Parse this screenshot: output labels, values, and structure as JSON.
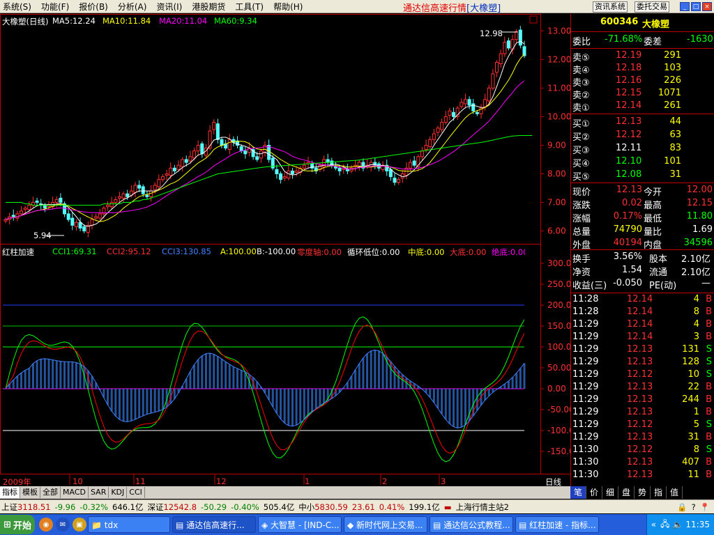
{
  "menu": {
    "items": [
      "系统(S)",
      "功能(F)",
      "报价(B)",
      "分析(A)",
      "资讯(I)",
      "港股期货",
      "工具(T)",
      "帮助(H)"
    ]
  },
  "app_title": "通达信高速行情",
  "app_title_tag": "[大橡塑]",
  "top_buttons": [
    "资讯系统",
    "委托交易"
  ],
  "window_controls": [
    "_",
    "□",
    "×"
  ],
  "chart_header": {
    "name": "大橡塑(日线)",
    "ma5": "MA5:12.24",
    "ma10": "MA10:11.84",
    "ma20": "MA20:11.04",
    "ma60": "MA60:9.34",
    "high_label": "12.98",
    "low_label": "5.94"
  },
  "indicator_header": {
    "name": "红柱加速",
    "cci1": "CCI1:69.31",
    "cci2": "CCI2:95.12",
    "cci3": "CCI3:130.85",
    "a": "A:100.00",
    "b": "B:-100.00",
    "zero": "零度轴:0.00",
    "cyc": "循环低位:0.00",
    "mid": "中底:0.00",
    "big": "大底:0.00",
    "abs": "绝底:0.00"
  },
  "x_axis": {
    "labels": [
      "2009年",
      "10",
      "11",
      "12",
      "1",
      "2",
      "3"
    ],
    "period": "日线"
  },
  "chart_data": [
    {
      "type": "candlestick",
      "title": "大橡塑(日线)",
      "ylim": [
        5.6,
        13.3
      ],
      "ticks": [
        "13.00",
        "12.00",
        "11.00",
        "10.00",
        "9.00",
        "8.00",
        "7.00",
        "6.00"
      ],
      "series": [
        {
          "name": "MA5:12.24",
          "color": "#ffffff"
        },
        {
          "name": "MA10:11.84",
          "color": "#ffff00"
        },
        {
          "name": "MA20:11.04",
          "color": "#ff00ff"
        },
        {
          "name": "MA60:9.34",
          "color": "#00ff00"
        }
      ],
      "close": [
        6.4,
        6.5,
        6.5,
        6.6,
        6.7,
        6.8,
        6.9,
        7.0,
        7.0,
        6.9,
        6.8,
        6.9,
        7.0,
        7.1,
        7.0,
        6.6,
        6.4,
        6.2,
        6.3,
        6.1,
        6.0,
        6.2,
        6.4,
        6.5,
        6.6,
        6.8,
        6.9,
        7.0,
        7.1,
        7.2,
        7.3,
        7.2,
        7.4,
        7.6,
        7.5,
        7.3,
        7.2,
        7.4,
        7.6,
        7.8,
        7.9,
        8.0,
        8.2,
        8.1,
        8.3,
        8.5,
        8.4,
        8.6,
        8.8,
        9.0,
        8.7,
        8.9,
        9.5,
        9.8,
        9.2,
        9.0,
        8.9,
        9.2,
        9.1,
        9.0,
        8.8,
        8.7,
        8.9,
        8.6,
        8.5,
        8.8,
        9.0,
        8.5,
        8.2,
        8.0,
        7.8,
        7.9,
        8.1,
        8.0,
        8.1,
        8.2,
        8.3,
        8.4,
        8.2,
        8.1,
        8.3,
        8.5,
        8.4,
        8.3,
        8.2,
        8.1,
        8.2,
        8.1,
        8.2,
        8.3,
        8.4,
        8.2,
        8.3,
        8.4,
        8.3,
        8.2,
        8.3,
        8.1,
        7.9,
        7.7,
        7.8,
        8.0,
        8.2,
        8.4,
        8.3,
        8.6,
        8.8,
        9.0,
        9.2,
        9.4,
        9.6,
        9.8,
        10.0,
        10.2,
        10.0,
        10.3,
        10.5,
        10.6,
        10.4,
        10.2,
        10.1,
        10.3,
        10.6,
        11.0,
        11.5,
        11.9,
        12.2,
        12.6,
        12.4,
        12.7,
        12.98,
        12.5,
        12.13
      ],
      "ma60": [
        7.0,
        7.0,
        7.0,
        7.0,
        7.0,
        6.95,
        6.95,
        6.9,
        6.9,
        6.9,
        6.9,
        6.9,
        6.9,
        6.9,
        6.9,
        6.9,
        6.9,
        6.9,
        6.9,
        6.9,
        6.9,
        6.9,
        6.9,
        6.9,
        6.9,
        6.95,
        6.95,
        6.95,
        6.95,
        6.95,
        7.0,
        7.0,
        7.0,
        7.05,
        7.05,
        7.1,
        7.1,
        7.15,
        7.2,
        7.25,
        7.3,
        7.35,
        7.4,
        7.45,
        7.5,
        7.55,
        7.6,
        7.65,
        7.7,
        7.75,
        7.8,
        7.85,
        7.9,
        7.95,
        8.0,
        8.02,
        8.04,
        8.06,
        8.08,
        8.1,
        8.12,
        8.14,
        8.16,
        8.18,
        8.2,
        8.22,
        8.24,
        8.25,
        8.26,
        8.27,
        8.28,
        8.29,
        8.3,
        8.31,
        8.32,
        8.33,
        8.34,
        8.35,
        8.36,
        8.37,
        8.38,
        8.39,
        8.4,
        8.41,
        8.42,
        8.43,
        8.44,
        8.45,
        8.46,
        8.47,
        8.48,
        8.5,
        8.52,
        8.54,
        8.56,
        8.58,
        8.6,
        8.62,
        8.64,
        8.66,
        8.68,
        8.7,
        8.72,
        8.74,
        8.76,
        8.78,
        8.8,
        8.82,
        8.84,
        8.86,
        8.88,
        8.9,
        8.92,
        8.94,
        8.96,
        8.98,
        9.0,
        9.02,
        9.04,
        9.06,
        9.08,
        9.1,
        9.12,
        9.15,
        9.18,
        9.21,
        9.24,
        9.27,
        9.3,
        9.32,
        9.33,
        9.34,
        9.34,
        9.34,
        9.34
      ]
    },
    {
      "type": "line",
      "title": "红柱加速",
      "ylim": [
        -200,
        330
      ],
      "ticks": [
        "300.00",
        "250.00",
        "200.00",
        "150.00",
        "100.00",
        "50.00",
        "0.00",
        "-50.00",
        "-100.00",
        "-150.00"
      ],
      "series": [
        {
          "name": "CCI1:69.31",
          "color": "#00ff00"
        },
        {
          "name": "CCI2:95.12",
          "color": "#ff0000"
        },
        {
          "name": "CCI3:130.85",
          "color": "#4080ff"
        }
      ],
      "reference_lines": [
        200,
        150,
        100,
        0,
        -100
      ]
    }
  ],
  "stock": {
    "code": "600346",
    "name": "大橡塑"
  },
  "order_ratio": {
    "label1": "委比",
    "value1": "-71.68%",
    "label2": "委差",
    "value2": "-1630"
  },
  "asks": [
    {
      "label": "卖⑤",
      "price": "12.19",
      "vol": "291"
    },
    {
      "label": "卖④",
      "price": "12.18",
      "vol": "103"
    },
    {
      "label": "卖③",
      "price": "12.16",
      "vol": "226"
    },
    {
      "label": "卖②",
      "price": "12.15",
      "vol": "1071"
    },
    {
      "label": "卖①",
      "price": "12.14",
      "vol": "261"
    }
  ],
  "bids": [
    {
      "label": "买①",
      "price": "12.13",
      "vol": "44"
    },
    {
      "label": "买②",
      "price": "12.12",
      "vol": "63"
    },
    {
      "label": "买③",
      "price": "12.11",
      "vol": "83"
    },
    {
      "label": "买④",
      "price": "12.10",
      "vol": "101"
    },
    {
      "label": "买⑤",
      "price": "12.08",
      "vol": "31"
    }
  ],
  "quote": [
    {
      "l1": "现价",
      "v1": "12.13",
      "l2": "今开",
      "v2": "12.00"
    },
    {
      "l1": "涨跌",
      "v1": "0.02",
      "l2": "最高",
      "v2": "12.15"
    },
    {
      "l1": "涨幅",
      "v1": "0.17%",
      "l2": "最低",
      "v2": "11.80"
    },
    {
      "l1": "总量",
      "v1": "74790",
      "l2": "量比",
      "v2": "1.69"
    },
    {
      "l1": "外盘",
      "v1": "40194",
      "l2": "内盘",
      "v2": "34596"
    }
  ],
  "fund": [
    {
      "l1": "换手",
      "v1": "3.56%",
      "l2": "股本",
      "v2": "2.10亿"
    },
    {
      "l1": "净资",
      "v1": "1.54",
      "l2": "流通",
      "v2": "2.10亿"
    },
    {
      "l1": "收益(三)",
      "v1": "-0.050",
      "l2": "PE(动)",
      "v2": "—"
    }
  ],
  "ticks": [
    {
      "t": "11:28",
      "p": "12.14",
      "v": "4",
      "s": "B"
    },
    {
      "t": "11:28",
      "p": "12.14",
      "v": "8",
      "s": "B"
    },
    {
      "t": "11:29",
      "p": "12.14",
      "v": "4",
      "s": "B"
    },
    {
      "t": "11:29",
      "p": "12.14",
      "v": "3",
      "s": "B"
    },
    {
      "t": "11:29",
      "p": "12.13",
      "v": "131",
      "s": "S"
    },
    {
      "t": "11:29",
      "p": "12.13",
      "v": "128",
      "s": "S"
    },
    {
      "t": "11:29",
      "p": "12.12",
      "v": "10",
      "s": "S"
    },
    {
      "t": "11:29",
      "p": "12.13",
      "v": "22",
      "s": "B"
    },
    {
      "t": "11:29",
      "p": "12.13",
      "v": "244",
      "s": "B"
    },
    {
      "t": "11:29",
      "p": "12.13",
      "v": "1",
      "s": "B"
    },
    {
      "t": "11:29",
      "p": "12.12",
      "v": "5",
      "s": "S"
    },
    {
      "t": "11:29",
      "p": "12.13",
      "v": "31",
      "s": "B"
    },
    {
      "t": "11:30",
      "p": "12.12",
      "v": "8",
      "s": "S"
    },
    {
      "t": "11:30",
      "p": "12.13",
      "v": "407",
      "s": "B"
    },
    {
      "t": "11:30",
      "p": "12.13",
      "v": "11",
      "s": "B"
    }
  ],
  "bottom_tabs": [
    "指标",
    "模板",
    "全部",
    "MACD",
    "SAR",
    "KDJ",
    "CCI"
  ],
  "right_tabs": [
    "笔",
    "价",
    "细",
    "盘",
    "势",
    "指",
    "值"
  ],
  "status": {
    "sh_label": "上证",
    "sh_val": "3118.51",
    "sh_chg": "-9.96",
    "sh_pct": "-0.32%",
    "sh_amt": "646.1亿",
    "sz_label": "深证",
    "sz_val": "12542.8",
    "sz_chg": "-50.29",
    "sz_pct": "-0.40%",
    "sz_amt": "505.4亿",
    "zx_label": "中小",
    "zx_val": "5830.59",
    "zx_chg": "23.61",
    "zx_pct": "0.41%",
    "zx_amt": "199.1亿",
    "server": "上海行情主站2"
  },
  "taskbar": {
    "start": "开始",
    "tasks": [
      "tdx",
      "通达信高速行...",
      "大智慧 - [IND-C...",
      "新时代网上交易...",
      "通达信公式教程...",
      "红柱加速 - 指标..."
    ],
    "clock": "11:35"
  }
}
